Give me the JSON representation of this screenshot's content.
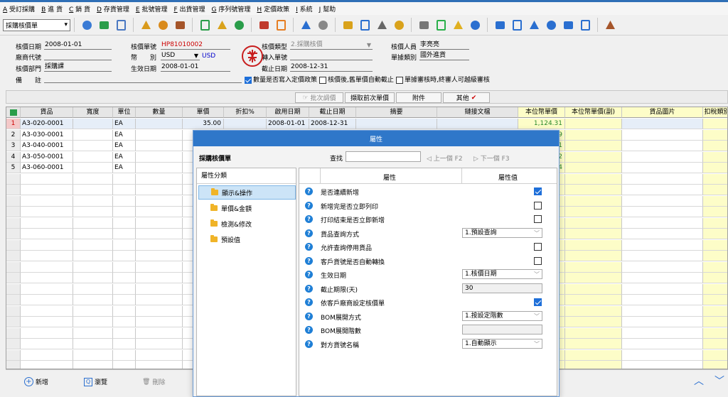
{
  "menu": [
    {
      "key": "A",
      "label": "受訂採購"
    },
    {
      "key": "B",
      "label": "進 貨"
    },
    {
      "key": "C",
      "label": "銷 貨"
    },
    {
      "key": "D",
      "label": "存貨管理"
    },
    {
      "key": "E",
      "label": "批號管理"
    },
    {
      "key": "F",
      "label": "出貨管理"
    },
    {
      "key": "G",
      "label": "序列號管理"
    },
    {
      "key": "H",
      "label": "定價政策"
    },
    {
      "key": "I",
      "label": "系統"
    },
    {
      "key": "J",
      "label": "幫助"
    }
  ],
  "toolbar": {
    "doc_type": "採購核價單",
    "icons": [
      "people-icon",
      "phone-icon",
      "computer-icon",
      "lock-icon",
      "briefcase-icon",
      "home-icon",
      "dollar-icon",
      "money-bag-icon",
      "cart-icon",
      "clipboard-icon",
      "users-icon",
      "rocket-icon",
      "help-doc-icon",
      "mail-icon",
      "info-icon",
      "calculator-icon",
      "folder-icon",
      "document-icon",
      "check-circle-icon",
      "bell-icon",
      "search-icon",
      "network-icon",
      "monitor-icon",
      "refresh-icon",
      "copy-icon",
      "close-box-icon",
      "window-icon",
      "exit-icon"
    ]
  },
  "form": {
    "date_label": "核價日期",
    "date": "2008-01-01",
    "vendor_label": "廠商代號",
    "vendor": "",
    "dept_label": "核價部門",
    "dept": "採購課",
    "note_label": "備　　註",
    "note": "",
    "docno_label": "核價單號",
    "docno": "HP81010002",
    "currency_label": "幣　　別",
    "currency": "USD",
    "currency_name": "USD",
    "effective_label": "生效日期",
    "effective": "2008-01-01",
    "pricetype_label": "核價類型",
    "pricetype": "2.採購核價",
    "source_label": "轉入單號",
    "source": "",
    "end_label": "截止日期",
    "end": "2008-12-31",
    "person_label": "核價人員",
    "person": "李亮亮",
    "category_label": "單據類別",
    "category": "國外進貨",
    "cb1": "數量是否寫入定價政策",
    "cb2": "核價後,舊單價自動截止",
    "cb3": "單據審核時,終審人可越級審核"
  },
  "actions": {
    "batch": "批次調價",
    "prev_price": "擷取前次單價",
    "attach": "附件",
    "other": "其他"
  },
  "grid": {
    "headers": [
      "貨品",
      "寬度",
      "單位",
      "數量",
      "單價",
      "折扣%",
      "啟用日期",
      "截止日期",
      "摘要",
      "鏈接文檔",
      "本位幣單價",
      "本位幣單價(副)",
      "貨品圖片",
      "扣稅類別"
    ],
    "rows": [
      {
        "no": "1",
        "item": "A3-020-0001",
        "unit": "EA",
        "price": "35.00",
        "start": "2008-01-01",
        "end": "2008-12-31",
        "base": "1,124.31"
      },
      {
        "no": "2",
        "item": "A3-030-0001",
        "unit": "EA",
        "price": "",
        "start": "",
        "end": "",
        "base": "9"
      },
      {
        "no": "3",
        "item": "A3-040-0001",
        "unit": "EA",
        "price": "",
        "start": "",
        "end": "",
        "base": "1"
      },
      {
        "no": "4",
        "item": "A3-050-0001",
        "unit": "EA",
        "price": "",
        "start": "",
        "end": "",
        "base": "2"
      },
      {
        "no": "5",
        "item": "A3-060-0001",
        "unit": "EA",
        "price": "",
        "start": "",
        "end": "",
        "base": "4"
      }
    ]
  },
  "bottom": {
    "add": "新增",
    "browse": "瀏覽",
    "delete": "刪除"
  },
  "dialog": {
    "title": "屬性",
    "form_name": "採購核價單",
    "find_label": "查找",
    "prev": "上一個 F2",
    "next": "下一個 F3",
    "tree_head": "屬性分類",
    "tree": [
      "顯示&操作",
      "單價&金額",
      "檢測&修改",
      "預設值"
    ],
    "col_prop": "屬性",
    "col_value": "屬性值",
    "props": [
      {
        "label": "是否連續新增",
        "type": "check",
        "checked": true
      },
      {
        "label": "新增完是否立即列印",
        "type": "check",
        "checked": false
      },
      {
        "label": "打印結束是否立即新增",
        "type": "check",
        "checked": false
      },
      {
        "label": "貨品查詢方式",
        "type": "select",
        "value": "1.預設查詢"
      },
      {
        "label": "允許查詢停用貨品",
        "type": "check",
        "checked": false
      },
      {
        "label": "客戶貨號是否自動轉換",
        "type": "check",
        "checked": false
      },
      {
        "label": "生效日期",
        "type": "select",
        "value": "1.核價日期"
      },
      {
        "label": "截止期限(天)",
        "type": "input",
        "value": "30"
      },
      {
        "label": "依客戶廠商設定核價單",
        "type": "check",
        "checked": true
      },
      {
        "label": "BOM展開方式",
        "type": "select",
        "value": "1.按設定階數"
      },
      {
        "label": "BOM展開階數",
        "type": "input",
        "value": ""
      },
      {
        "label": "對方貨號名稱",
        "type": "select",
        "value": "1.自動顯示"
      }
    ]
  }
}
